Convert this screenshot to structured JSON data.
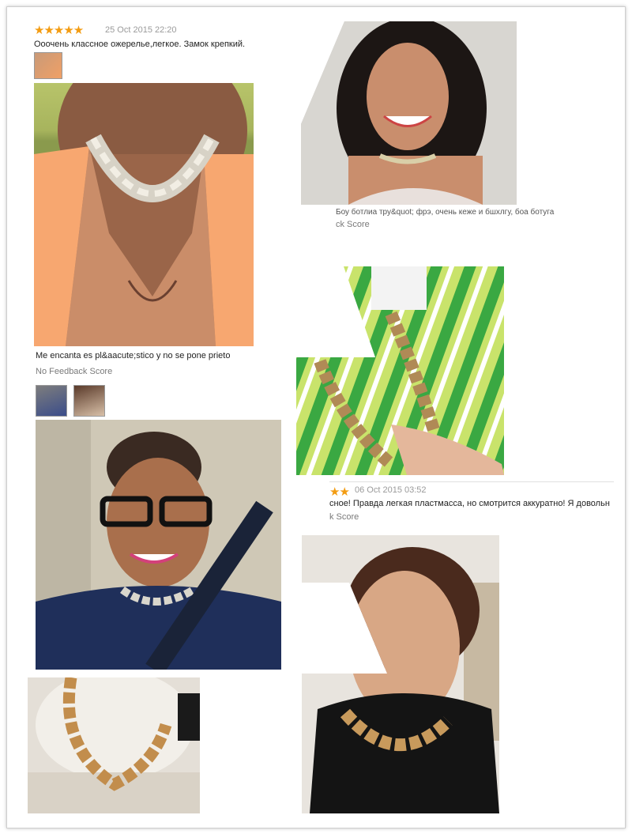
{
  "review1": {
    "stars": "★★★★★",
    "date": "25 Oct 2015 22:20",
    "text": "Ооочень классное ожерелье,легкое. Замок крепкий."
  },
  "review2": {
    "text_partial": "Боу ботлиа тру&quot; фрэ, очень кеже и бшхлгу, боа ботуга",
    "feedback_partial": "ck Score"
  },
  "review3": {
    "text": "Me encanta es pl&aacute;stico y no se pone prieto",
    "feedback": "No Feedback Score"
  },
  "review4": {
    "stars": "★★",
    "date": "06 Oct 2015 03:52",
    "text_partial": "сное! Правда легкая пластмасса, но смотрится аккуратно! Я довольн",
    "feedback_partial": "k Score"
  },
  "colors": {
    "star": "#f39c12",
    "tank_top": "#f7a770",
    "stripe_green": "#3aa842",
    "stripe_lime": "#c9e36b"
  }
}
